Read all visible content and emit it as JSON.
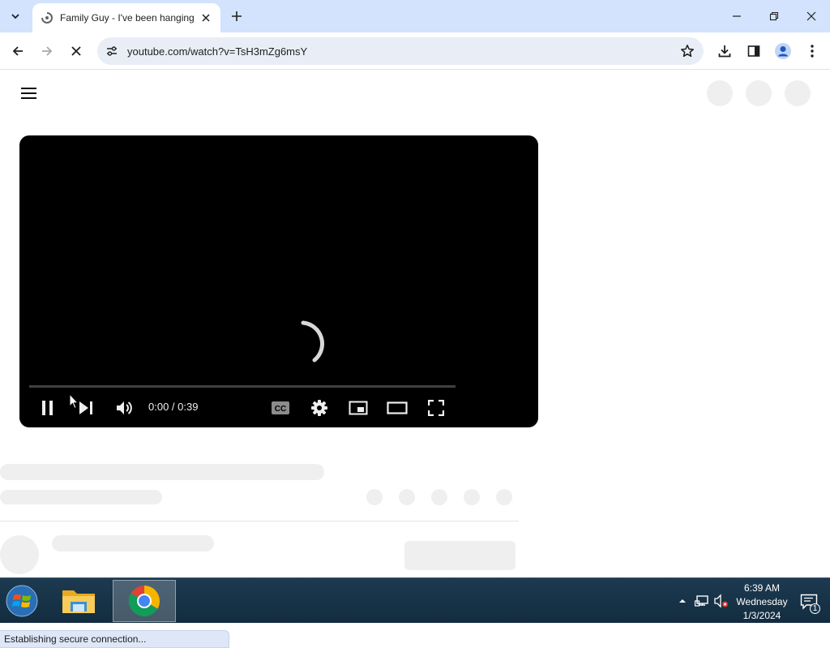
{
  "browser": {
    "tab": {
      "title": "Family Guy - I've been hanging"
    },
    "address_bar": {
      "url": "youtube.com/watch?v=TsH3mZg6msY"
    },
    "status_text": "Establishing secure connection..."
  },
  "player": {
    "time_display": "0:00 / 0:39",
    "progress_fraction": 0.0,
    "state": "loading"
  },
  "taskbar": {
    "apps": [
      "windows-explorer",
      "google-chrome"
    ],
    "clock": {
      "time": "6:39 AM",
      "day": "Wednesday",
      "date": "1/3/2024"
    },
    "notification_count": "1"
  },
  "colors": {
    "tabstrip_bg": "#d3e3fd",
    "omnibox_bg": "#e9eef6",
    "player_bg": "#000000",
    "placeholder_gray": "#efefef",
    "taskbar_bg": "#1c3a50"
  }
}
